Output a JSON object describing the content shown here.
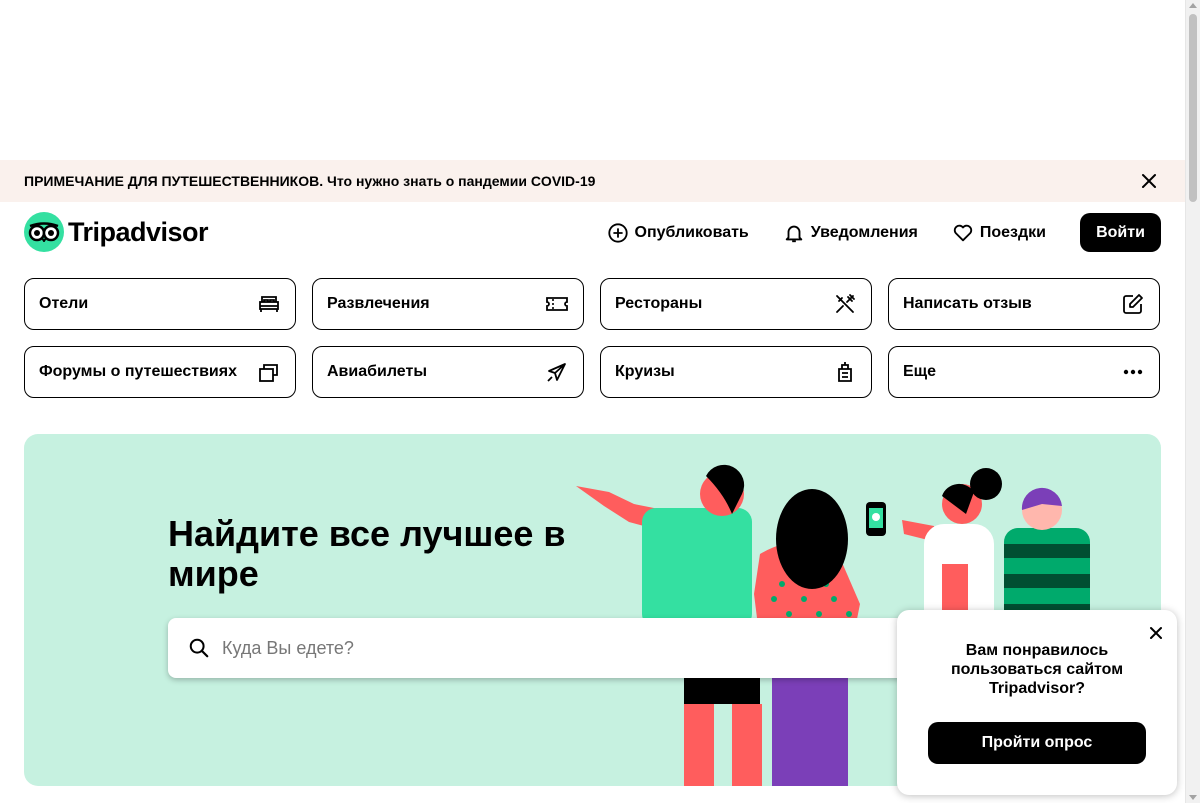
{
  "banner": {
    "bold_text": "ПРИМЕЧАНИЕ ДЛЯ ПУТЕШЕСТВЕННИКОВ.",
    "text": " Что нужно знать о пандемии COVID-19"
  },
  "header": {
    "logo_text": "Tripadvisor",
    "nav": {
      "publish": "Опубликовать",
      "notifications": "Уведомления",
      "trips": "Поездки"
    },
    "login_label": "Войти"
  },
  "categories": [
    {
      "label": "Отели",
      "icon": "bed-icon"
    },
    {
      "label": "Развлечения",
      "icon": "ticket-icon"
    },
    {
      "label": "Рестораны",
      "icon": "utensils-icon"
    },
    {
      "label": "Написать отзыв",
      "icon": "edit-icon"
    },
    {
      "label": "Форумы о путешествиях",
      "icon": "forum-icon"
    },
    {
      "label": "Авиабилеты",
      "icon": "plane-icon"
    },
    {
      "label": "Круизы",
      "icon": "ship-icon"
    },
    {
      "label": "Еще",
      "icon": "more-icon"
    }
  ],
  "hero": {
    "title": "Найдите все лучшее в мире",
    "search_placeholder": "Куда Вы едете?"
  },
  "survey": {
    "text": "Вам понравилось пользоваться сайтом Tripadvisor?",
    "button_label": "Пройти опрос"
  },
  "colors": {
    "brand_green": "#34e0a1",
    "hero_bg": "#c6f1e0",
    "banner_bg": "#faf1ed"
  }
}
